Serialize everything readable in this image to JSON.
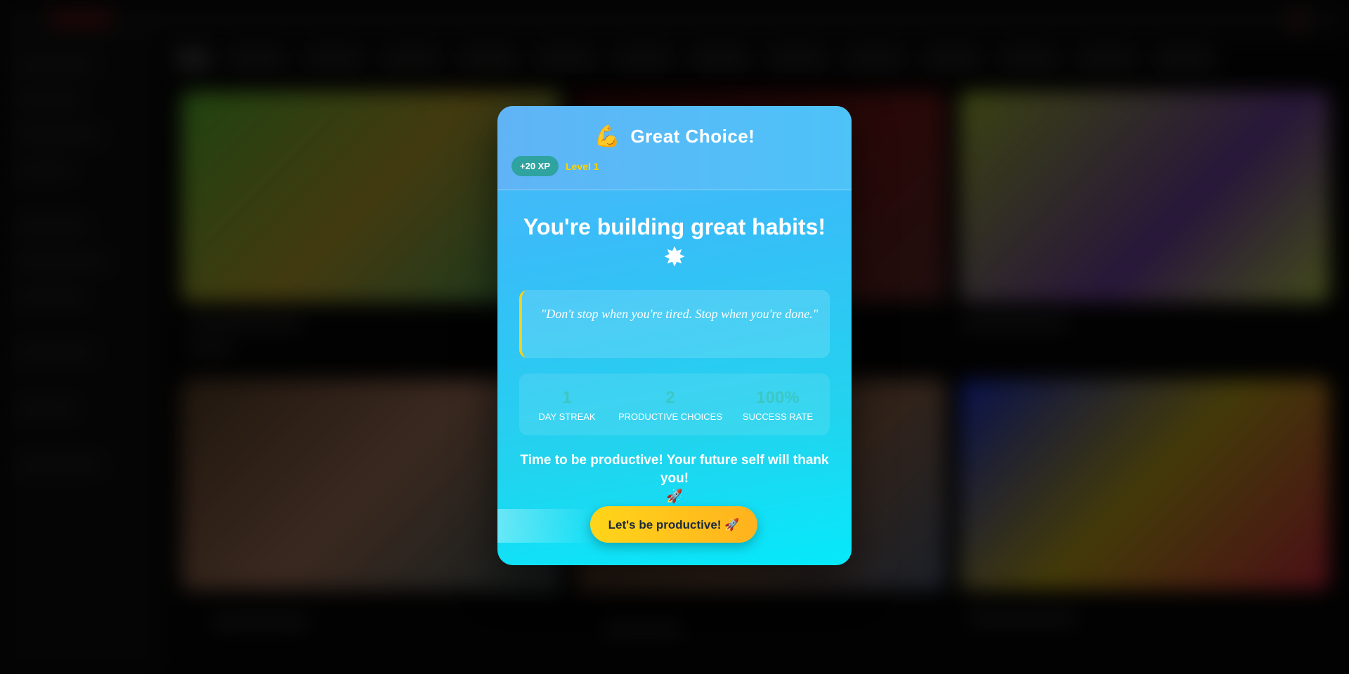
{
  "modal": {
    "title_icon": "💪",
    "title": "Great Choice!",
    "xp_badge": "+20 XP",
    "level": "Level 1",
    "headline": "You're building great habits!",
    "headline_icon": "✸",
    "quote": "\"Don't stop when you're tired. Stop when you're done.\"",
    "stats": [
      {
        "value": "1",
        "label": "DAY STREAK"
      },
      {
        "value": "2",
        "label": "PRODUCTIVE CHOICES"
      },
      {
        "value": "100%",
        "label": "SUCCESS RATE"
      }
    ],
    "tagline": "Time to be productive! Your future self will thank you!",
    "tagline_icon": "🚀",
    "cta_label": "Let's be productive! 🚀"
  },
  "colors": {
    "modal_gradient_start": "#4fb6f7",
    "modal_gradient_end": "#06e9fb",
    "accent_yellow": "#ffd400",
    "xp_badge": "#2fa3a0",
    "quote_border": "#f7d21a",
    "cta_gradient_start": "#ffd51a",
    "cta_gradient_end": "#ffb21e"
  }
}
